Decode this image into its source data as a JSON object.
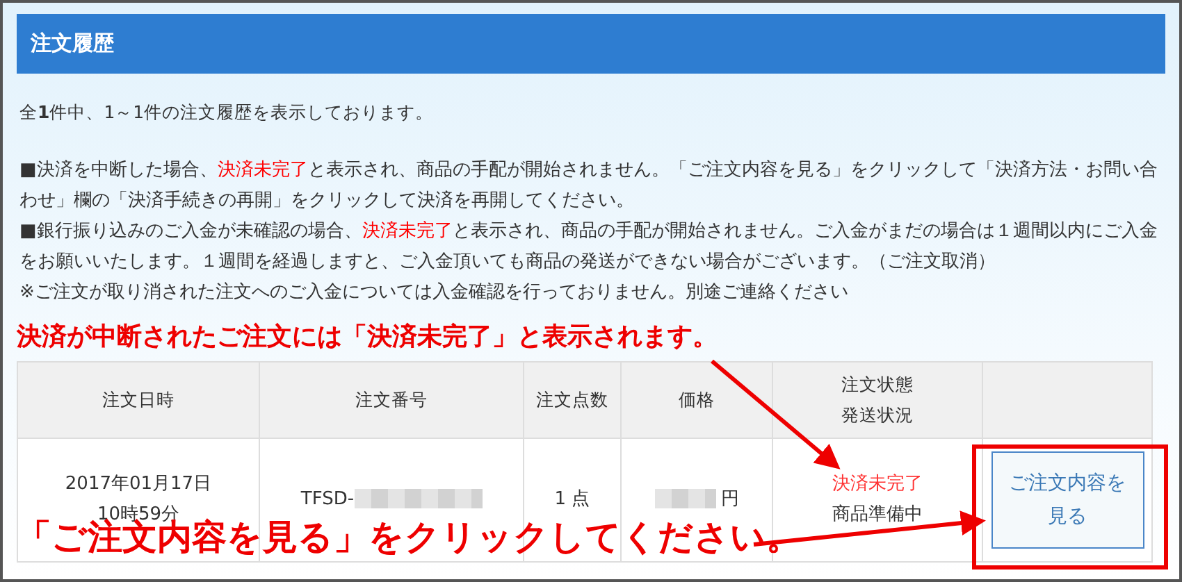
{
  "header": {
    "title": "注文履歴"
  },
  "summary": "全**1**件中、1～1件の注文履歴を表示しております。",
  "notices": [
    {
      "segments": [
        {
          "text": "■決済を中断した場合、",
          "highlight": false
        },
        {
          "text": "決済未完了",
          "highlight": true
        },
        {
          "text": "と表示され、商品の手配が開始されません。「ご注文内容を見る」をクリックして「決済方法・お問い合わせ」欄の「決済手続きの再開」をクリックして決済を再開してください。",
          "highlight": false
        }
      ]
    },
    {
      "segments": [
        {
          "text": "■銀行振り込みのご入金が未確認の場合、",
          "highlight": false
        },
        {
          "text": "決済未完了",
          "highlight": true
        },
        {
          "text": "と表示され、商品の手配が開始されません。ご入金がまだの場合は１週間以内にご入金をお願いいたします。１週間を経過しますと、ご入金頂いても商品の発送ができない場合がございます。（ご注文取消）",
          "highlight": false
        }
      ]
    },
    {
      "segments": [
        {
          "text": "※ご注文が取り消された注文へのご入金については入金確認を行っておりません。別途ご連絡ください",
          "highlight": false
        }
      ]
    }
  ],
  "table": {
    "columns": [
      {
        "lines": [
          "注文日時"
        ]
      },
      {
        "lines": [
          "注文番号"
        ]
      },
      {
        "lines": [
          "注文点数"
        ]
      },
      {
        "lines": [
          "価格"
        ]
      },
      {
        "lines": [
          "注文状態",
          "発送状況"
        ]
      }
    ],
    "rows": [
      {
        "date": [
          "2017年01月17日",
          "10時59分"
        ],
        "order_number": {
          "text": "TFSD-",
          "masked": true
        },
        "count": "1 点",
        "price": {
          "text": "円",
          "masked": true
        },
        "payment_status": "決済未完了",
        "shipping_status": "商品準備中",
        "button": "ご注文内容を見る"
      }
    ]
  },
  "callouts": [
    {
      "text": "決済が中断されたご注文には「決済未完了」と表示されます。"
    },
    {
      "text": "「ご注文内容を見る」をクリックしてください。"
    }
  ]
}
